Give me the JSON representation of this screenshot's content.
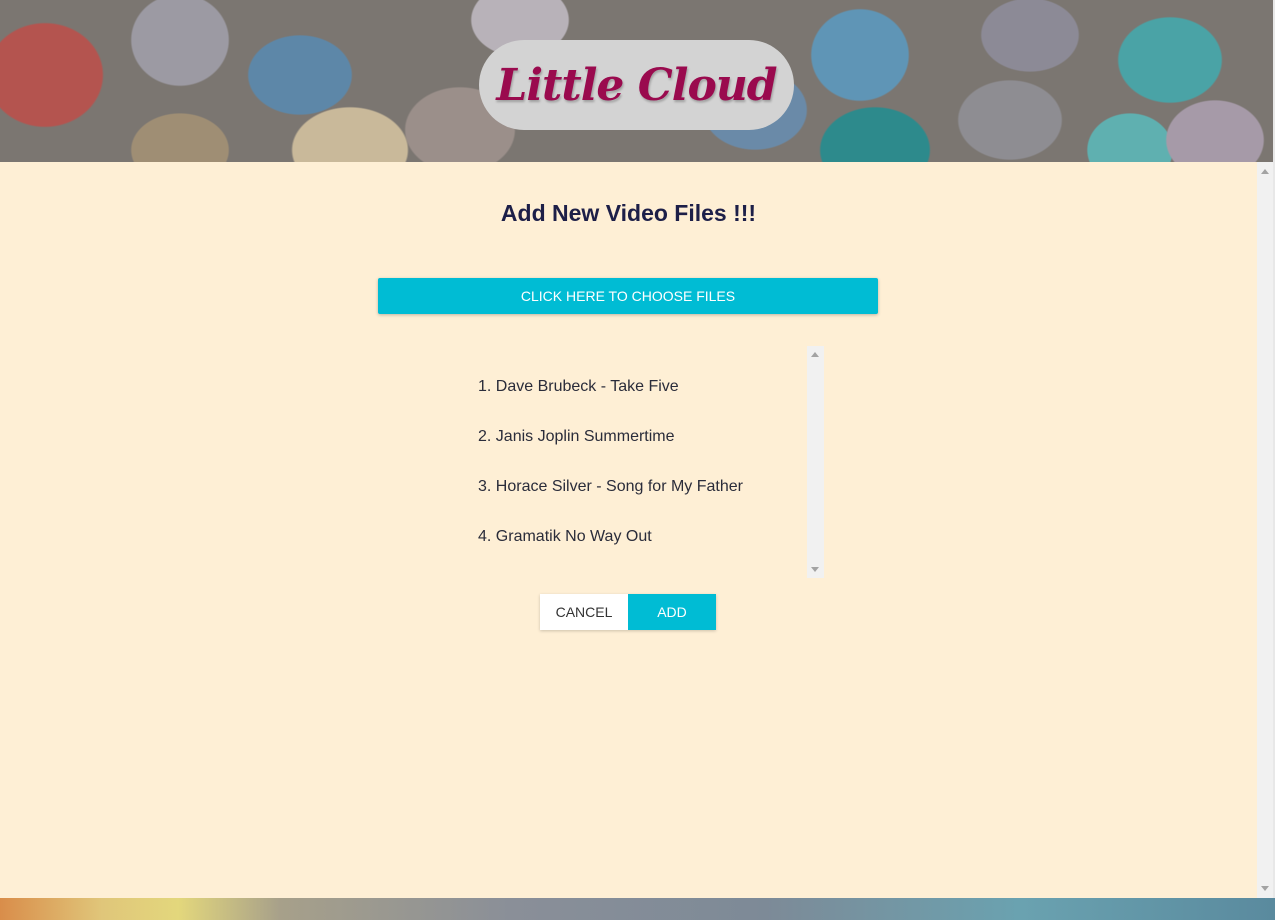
{
  "header": {
    "logo_text": "Little Cloud"
  },
  "main": {
    "title": "Add New Video Files !!!",
    "choose_files_label": "CLICK HERE TO CHOOSE FILES",
    "files": [
      "1. Dave Brubeck - Take Five",
      "2. Janis Joplin Summertime",
      "3. Horace Silver - Song for My Father",
      "4. Gramatik No Way Out"
    ],
    "cancel_label": "CANCEL",
    "add_label": "ADD"
  },
  "colors": {
    "accent": "#00bcd4",
    "logo_text": "#9a0a4e",
    "panel_background": "#feefd5",
    "title_text": "#1d1f48"
  }
}
